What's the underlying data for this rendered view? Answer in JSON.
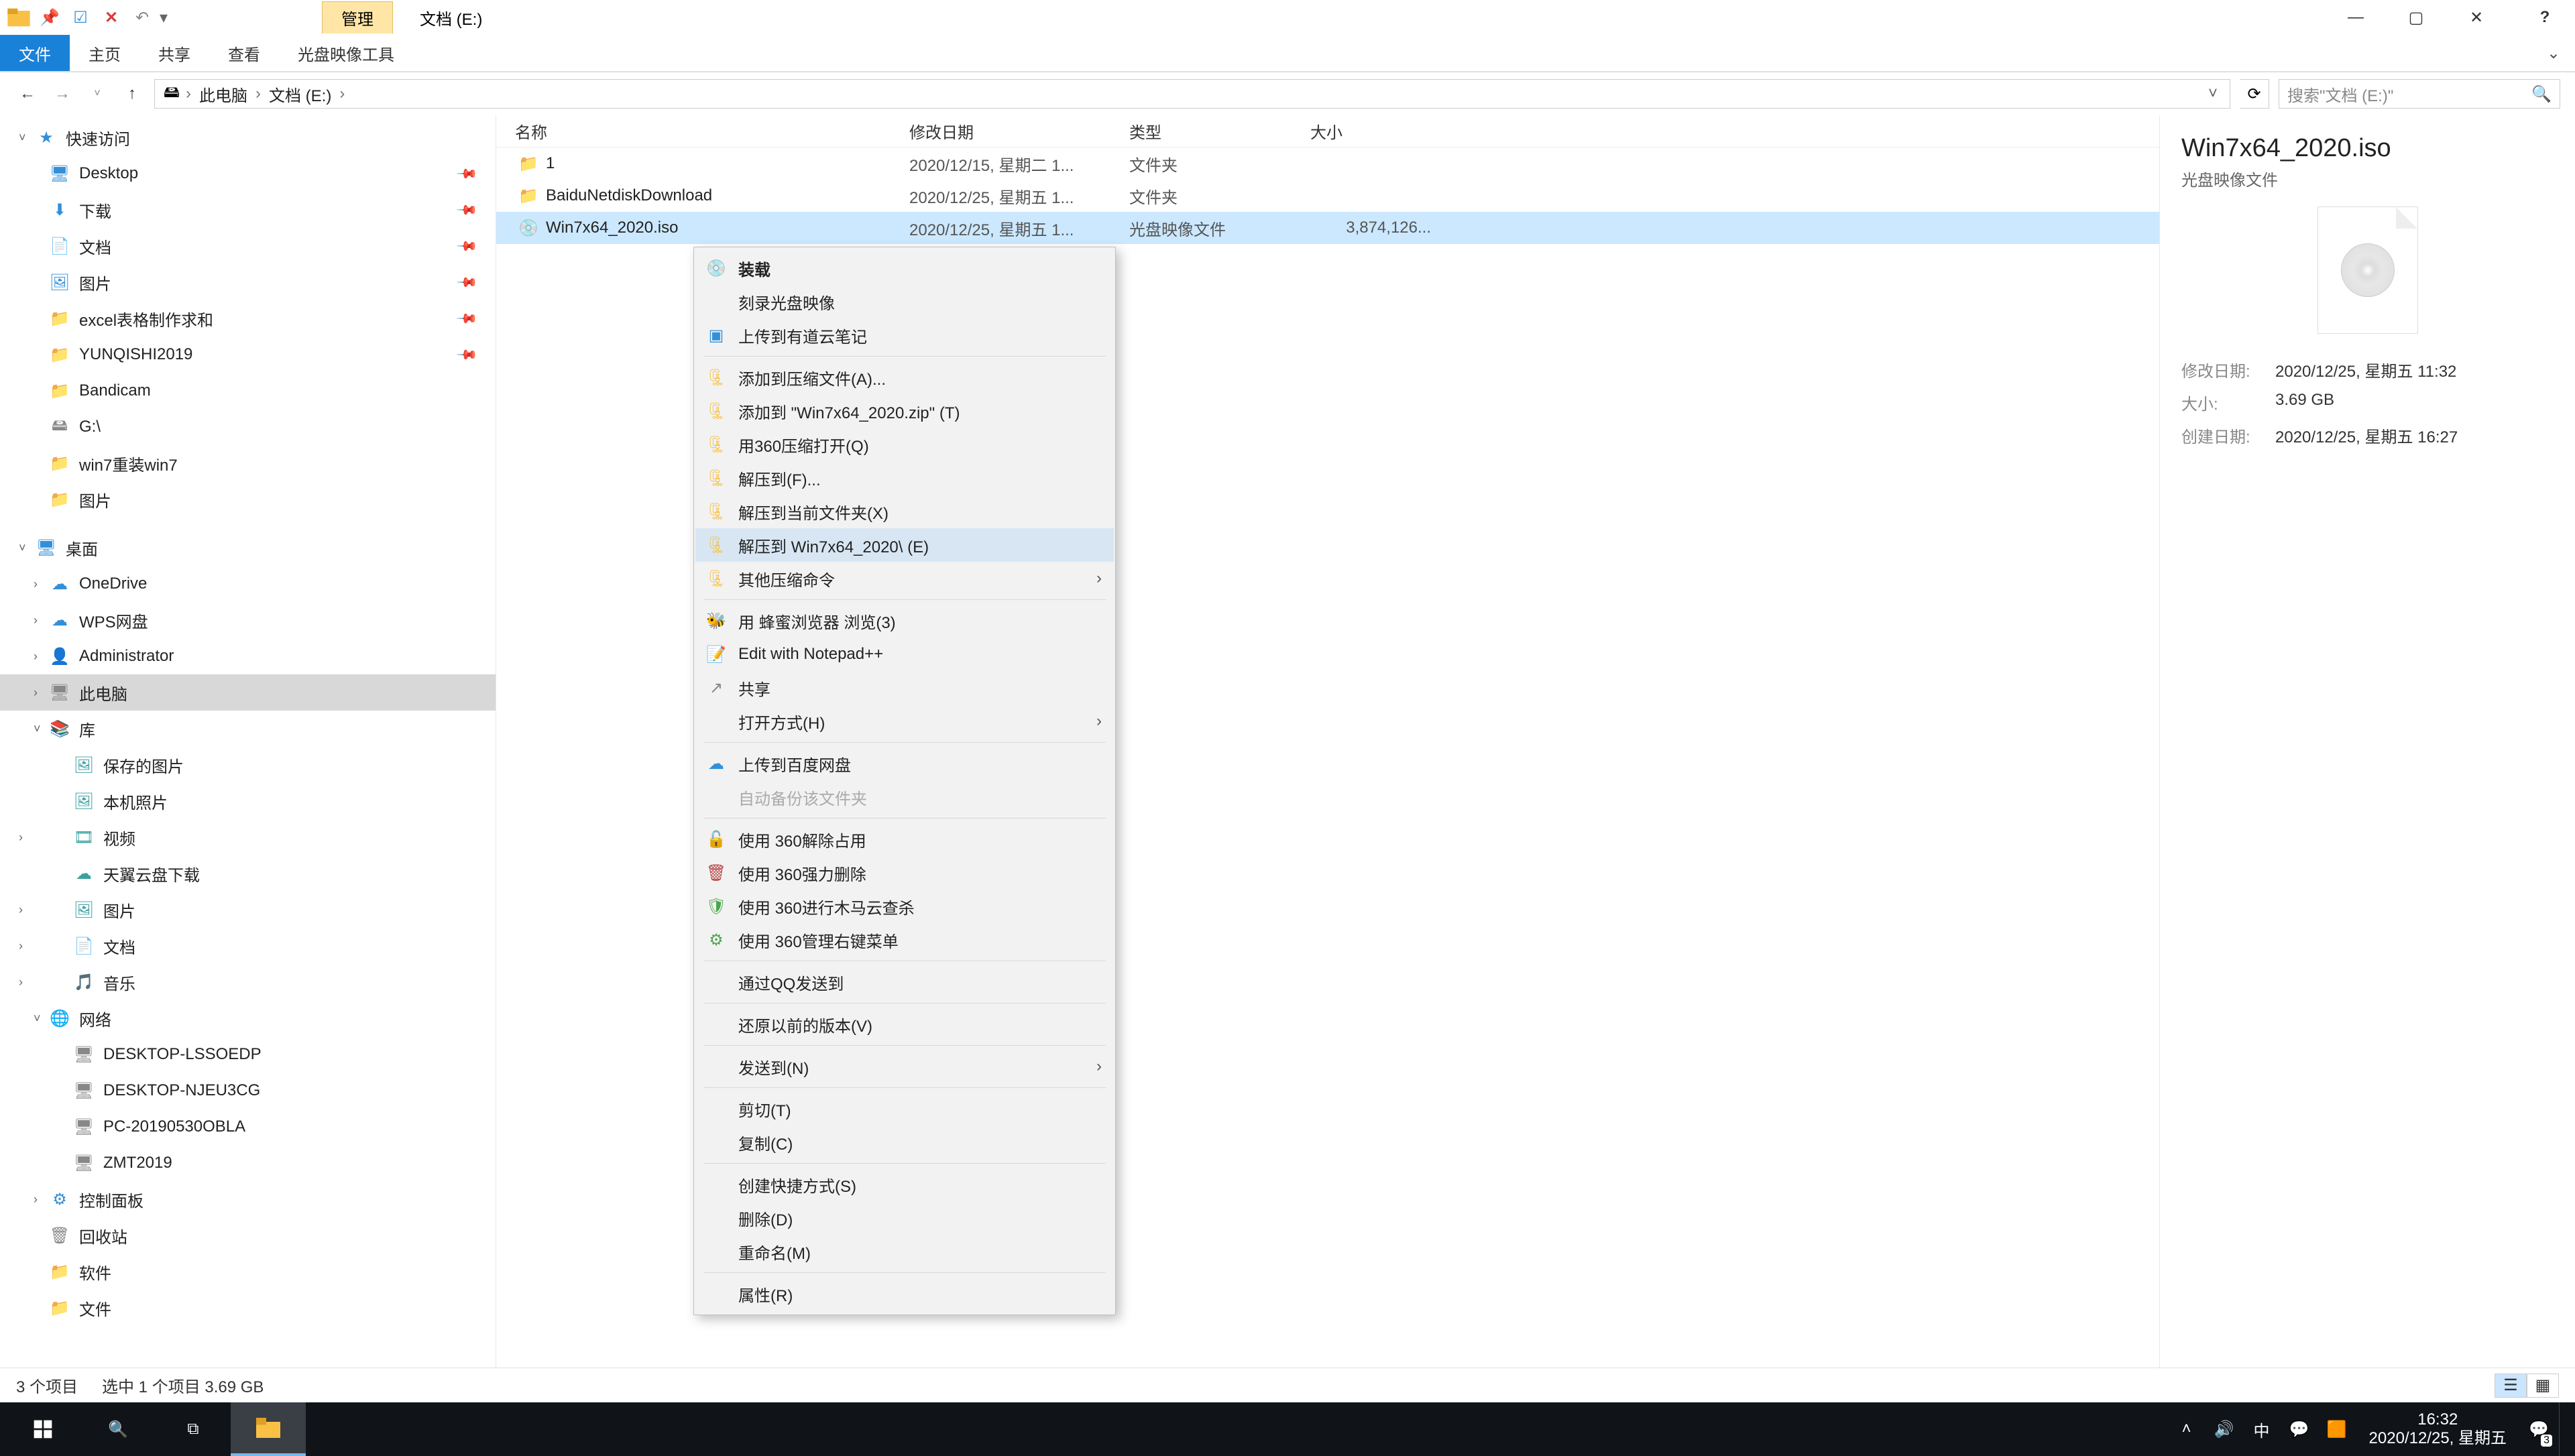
{
  "titlebar": {
    "manage_label": "管理",
    "window_title": "文档 (E:)"
  },
  "ribbon_tabs": {
    "file": "文件",
    "home": "主页",
    "share": "共享",
    "view": "查看",
    "tool": "光盘映像工具"
  },
  "breadcrumb": {
    "seg0": "此电脑",
    "seg1": "文档 (E:)"
  },
  "search": {
    "placeholder": "搜索\"文档 (E:)\""
  },
  "columns": {
    "name": "名称",
    "date": "修改日期",
    "type": "类型",
    "size": "大小"
  },
  "rows": [
    {
      "name": "1",
      "date": "2020/12/15, 星期二 1...",
      "type": "文件夹",
      "size": ""
    },
    {
      "name": "BaiduNetdiskDownload",
      "date": "2020/12/25, 星期五 1...",
      "type": "文件夹",
      "size": ""
    },
    {
      "name": "Win7x64_2020.iso",
      "date": "2020/12/25, 星期五 1...",
      "type": "光盘映像文件",
      "size": "3,874,126..."
    }
  ],
  "nav": {
    "quick": "快速访问",
    "desktop": "Desktop",
    "downloads": "下载",
    "documents": "文档",
    "pictures": "图片",
    "excel": "excel表格制作求和",
    "yunqishi": "YUNQISHI2019",
    "bandicam": "Bandicam",
    "gdrive": "G:\\",
    "win7": "win7重装win7",
    "pictures2": "图片",
    "desk_group": "桌面",
    "onedrive": "OneDrive",
    "wps": "WPS网盘",
    "admin": "Administrator",
    "thispc": "此电脑",
    "libs": "库",
    "saved_pics": "保存的图片",
    "local_pics": "本机照片",
    "videos": "视频",
    "tianyi": "天翼云盘下载",
    "lib_pics": "图片",
    "lib_docs": "文档",
    "lib_music": "音乐",
    "network": "网络",
    "desk1": "DESKTOP-LSSOEDP",
    "desk2": "DESKTOP-NJEU3CG",
    "pc1": "PC-20190530OBLA",
    "zmt": "ZMT2019",
    "cpanel": "控制面板",
    "recycle": "回收站",
    "software": "软件",
    "files": "文件"
  },
  "ctx": {
    "mount": "装载",
    "burn": "刻录光盘映像",
    "youdao": "上传到有道云笔记",
    "add_archive": "添加到压缩文件(A)...",
    "add_zip": "添加到 \"Win7x64_2020.zip\" (T)",
    "open360": "用360压缩打开(Q)",
    "extractF": "解压到(F)...",
    "extractX": "解压到当前文件夹(X)",
    "extractE": "解压到 Win7x64_2020\\ (E)",
    "other_compress": "其他压缩命令",
    "honey": "用 蜂蜜浏览器 浏览(3)",
    "notepad": "Edit with Notepad++",
    "share": "共享",
    "openwith": "打开方式(H)",
    "baidu": "上传到百度网盘",
    "autobak": "自动备份该文件夹",
    "u360_unlock": "使用 360解除占用",
    "u360_delete": "使用 360强力删除",
    "u360_scan": "使用 360进行木马云查杀",
    "u360_menu": "使用 360管理右键菜单",
    "qq": "通过QQ发送到",
    "restore": "还原以前的版本(V)",
    "sendto": "发送到(N)",
    "cut": "剪切(T)",
    "copy": "复制(C)",
    "shortcut": "创建快捷方式(S)",
    "delete": "删除(D)",
    "rename": "重命名(M)",
    "props": "属性(R)"
  },
  "details": {
    "title": "Win7x64_2020.iso",
    "subtitle": "光盘映像文件",
    "mod_k": "修改日期:",
    "mod_v": "2020/12/25, 星期五 11:32",
    "size_k": "大小:",
    "size_v": "3.69 GB",
    "create_k": "创建日期:",
    "create_v": "2020/12/25, 星期五 16:27"
  },
  "status": {
    "count": "3 个项目",
    "sel": "选中 1 个项目  3.69 GB"
  },
  "taskbar": {
    "ime": "中",
    "time": "16:32",
    "date": "2020/12/25, 星期五",
    "badge": "3"
  }
}
